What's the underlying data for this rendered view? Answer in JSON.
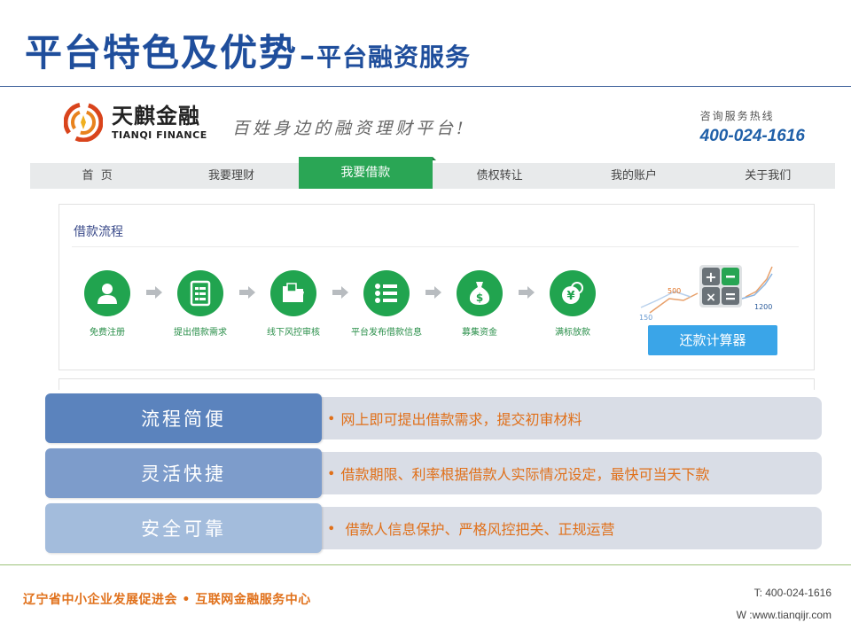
{
  "slide": {
    "title_main": "平台特色及优势",
    "title_dash": "–",
    "title_sub": "平台融资服务"
  },
  "site": {
    "logo_cn": "天麒金融",
    "logo_en": "TIANQI FINANCE",
    "slogan": "百姓身边的融资理财平台!",
    "hotline_label": "咨询服务热线",
    "hotline_number": "400-024-1616",
    "nav": [
      {
        "label": "首  页"
      },
      {
        "label": "我要理财"
      },
      {
        "label": "我要借款",
        "active": true
      },
      {
        "label": "债权转让"
      },
      {
        "label": "我的账户"
      },
      {
        "label": "关于我们"
      }
    ],
    "flow_title": "借款流程",
    "steps": [
      {
        "label": "免费注册",
        "icon": "user-icon"
      },
      {
        "label": "提出借款需求",
        "icon": "document-icon"
      },
      {
        "label": "线下风控审核",
        "icon": "folder-icon"
      },
      {
        "label": "平台发布借款信息",
        "icon": "list-icon"
      },
      {
        "label": "募集资金",
        "icon": "money-bag-icon"
      },
      {
        "label": "满标放款",
        "icon": "yen-coins-icon"
      }
    ],
    "calc_values": [
      "500",
      "150",
      "1200"
    ],
    "calc_button": "还款计算器"
  },
  "features": [
    {
      "label": "流程简便",
      "desc": "网上即可提出借款需求，提交初审材料",
      "color": "#5b83bd"
    },
    {
      "label": "灵活快捷",
      "desc": "借款期限、利率根据借款人实际情况设定，最快可当天下款",
      "color": "#7d9ccb"
    },
    {
      "label": "安全可靠",
      "desc": " 借款人信息保护、严格风控把关、正规运营",
      "color": "#a3bcdc"
    }
  ],
  "footer": {
    "org": "辽宁省中小企业发展促进会 • 互联网金融服务中心",
    "tel": "T: 400-024-1616",
    "web": "W :www.tianqijr.com"
  },
  "colors": {
    "title_blue": "#1f4e9c",
    "brand_green": "#21a44f",
    "accent_orange": "#e0701a",
    "button_blue": "#3aa5e8"
  }
}
